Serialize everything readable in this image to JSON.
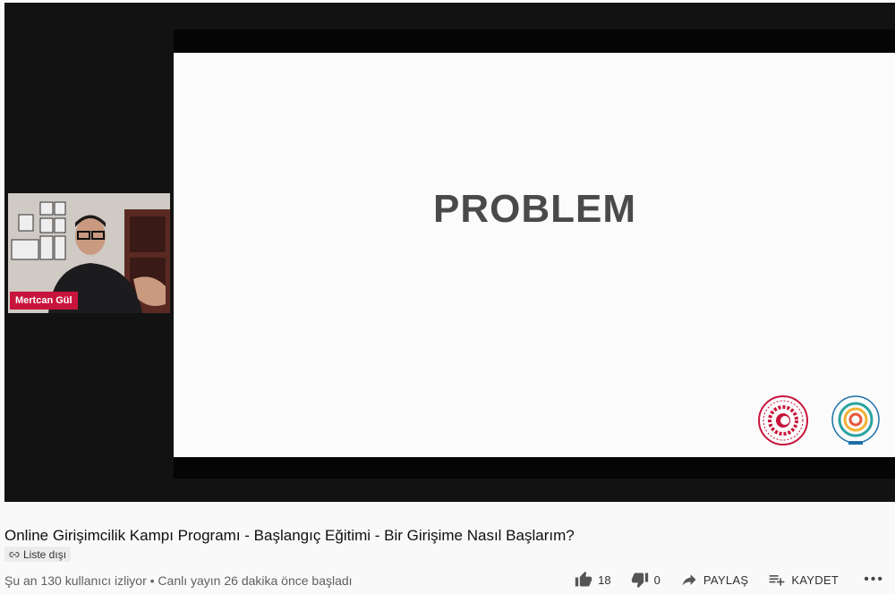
{
  "video": {
    "slide_title": "PROBLEM",
    "presenter_name": "Mertcan Gül"
  },
  "info": {
    "title": "Online Girişimcilik Kampı Programı - Başlangıç Eğitimi - Bir Girişime Nasıl Başlarım?",
    "visibility_badge": "Liste dışı",
    "stats": "Şu an 130 kullanıcı izliyor • Canlı yayın 26 dakika önce başladı"
  },
  "actions": {
    "likes": "18",
    "dislikes": "0",
    "share_label": "PAYLAŞ",
    "save_label": "KAYDET",
    "more_label": "•••"
  },
  "icons": {
    "like": "thumb-up-icon",
    "dislike": "thumb-down-icon",
    "share": "share-arrow-icon",
    "save": "playlist-add-icon",
    "link": "link-icon"
  }
}
